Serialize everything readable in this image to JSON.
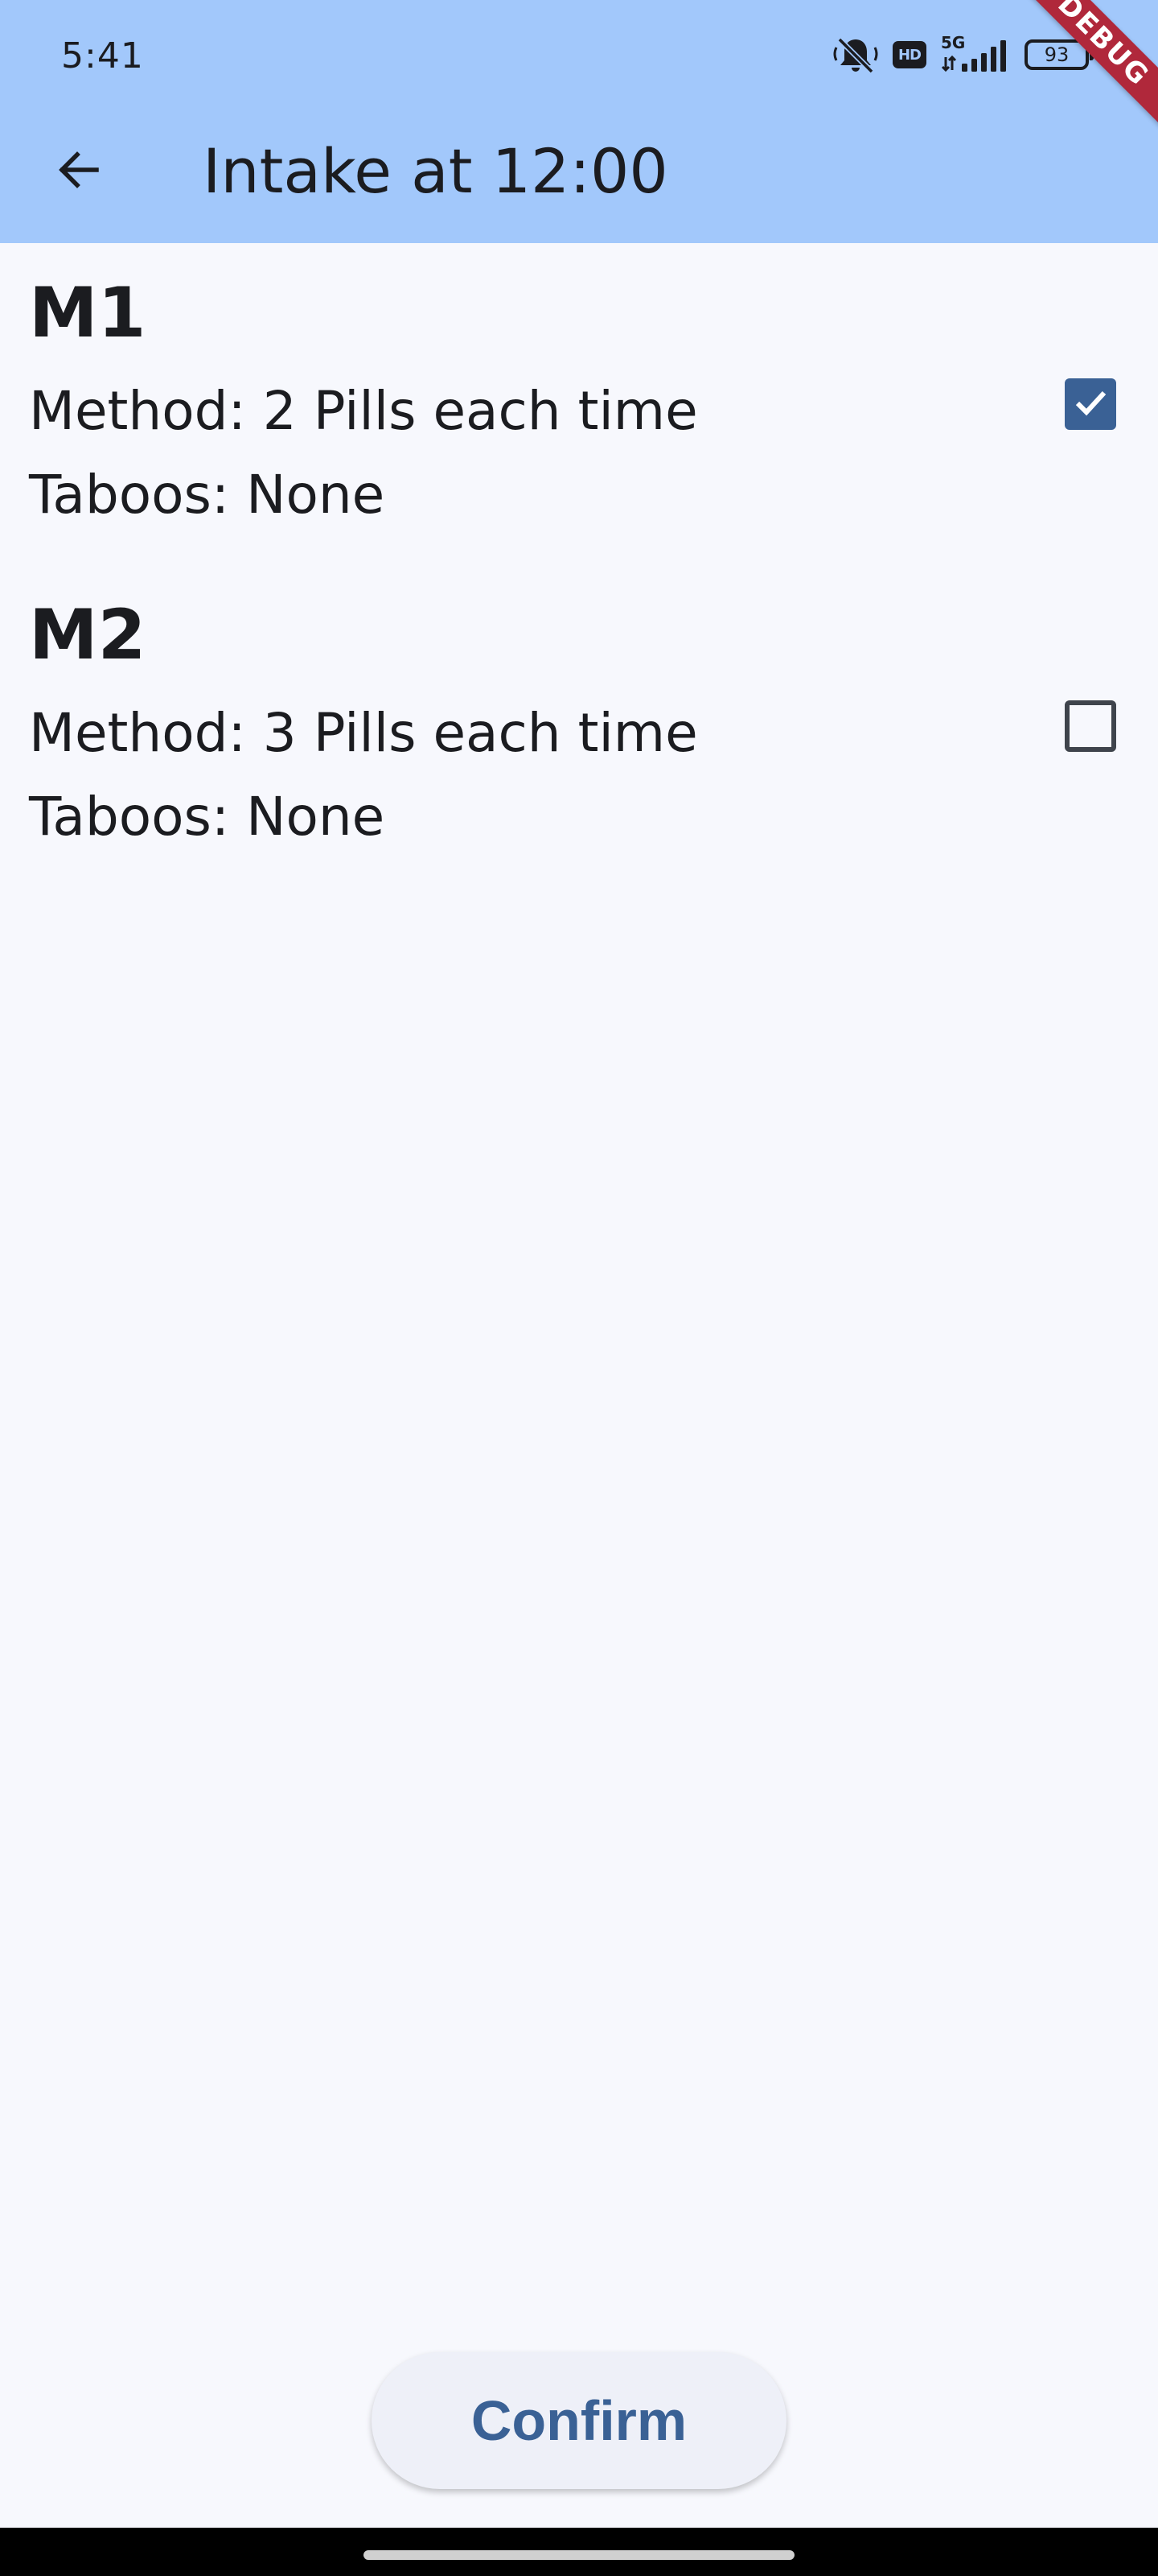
{
  "status_bar": {
    "time": "5:41",
    "network_label": "5G",
    "hd_label": "HD",
    "battery_level": "93"
  },
  "app_bar": {
    "title": "Intake at 12:00",
    "back_icon": "arrow-left-icon"
  },
  "debug_banner": "DEBUG",
  "medications": [
    {
      "name": "M1",
      "method": "Method: 2 Pills each time",
      "taboos": "Taboos: None",
      "checked": true
    },
    {
      "name": "M2",
      "method": "Method: 3 Pills each time",
      "taboos": "Taboos: None",
      "checked": false
    }
  ],
  "confirm_label": "Confirm",
  "colors": {
    "app_bar_bg": "#a2c8fb",
    "accent": "#3a6195",
    "background": "#f7f8fd",
    "debug_ribbon": "#b0283b"
  }
}
